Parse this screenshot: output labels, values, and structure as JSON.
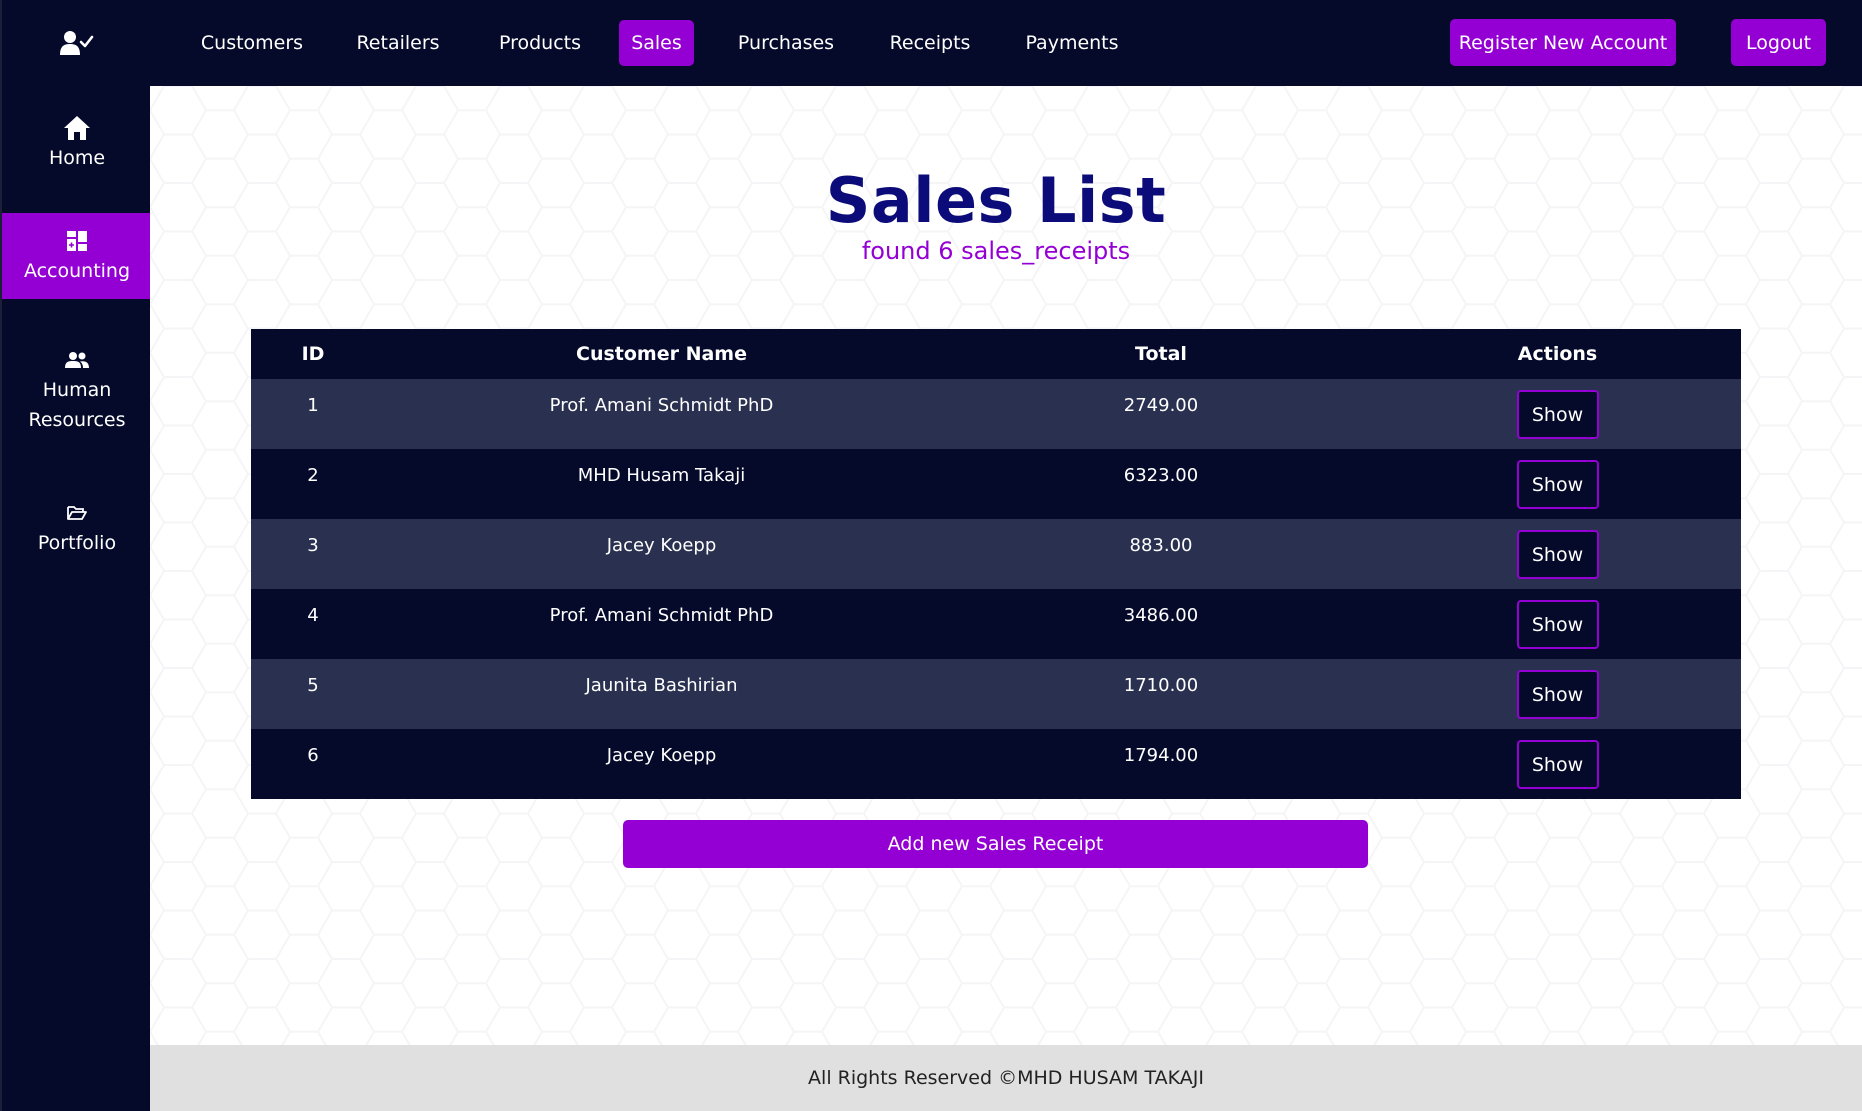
{
  "sidebar": {
    "logo_icon": "user-check-icon",
    "items": [
      {
        "label": "Home",
        "icon": "home-icon"
      },
      {
        "label": "Accounting",
        "icon": "dashboard-icon"
      },
      {
        "label": "Human Resources",
        "icon": "users-icon"
      },
      {
        "label": "Portfolio",
        "icon": "folder-open-icon"
      }
    ],
    "active_item": "Accounting"
  },
  "topnav": {
    "links": [
      "Customers",
      "Retailers",
      "Products",
      "Sales",
      "Purchases",
      "Receipts",
      "Payments"
    ],
    "active_link": "Sales",
    "register_label": "Register New Account",
    "logout_label": "Logout"
  },
  "main": {
    "title": "Sales List",
    "subtitle": "found 6 sales_receipts",
    "table": {
      "headers": [
        "ID",
        "Customer Name",
        "Total",
        "Actions"
      ],
      "rows": [
        {
          "id": "1",
          "customer": "Prof. Amani Schmidt PhD",
          "total": "2749.00",
          "action": "Show"
        },
        {
          "id": "2",
          "customer": "MHD Husam Takaji",
          "total": "6323.00",
          "action": "Show"
        },
        {
          "id": "3",
          "customer": "Jacey Koepp",
          "total": "883.00",
          "action": "Show"
        },
        {
          "id": "4",
          "customer": "Prof. Amani Schmidt PhD",
          "total": "3486.00",
          "action": "Show"
        },
        {
          "id": "5",
          "customer": "Jaunita Bashirian",
          "total": "1710.00",
          "action": "Show"
        },
        {
          "id": "6",
          "customer": "Jacey Koepp",
          "total": "1794.00",
          "action": "Show"
        }
      ]
    },
    "add_button_label": "Add new Sales Receipt"
  },
  "footer": {
    "text": "All Rights Reserved ©MHD HUSAM TAKAJI"
  },
  "colors": {
    "navy": "#050a2a",
    "accent": "#9400d3",
    "title": "#0b0b7a",
    "row_alt": "#2a3150",
    "footer_bg": "#e0e0e0"
  }
}
